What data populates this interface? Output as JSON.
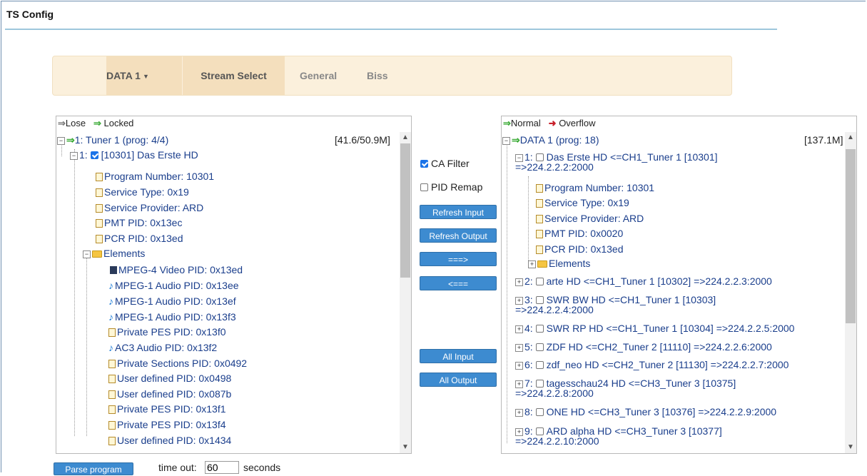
{
  "title": "TS Config",
  "tabs": [
    {
      "label": "DATA 1"
    },
    {
      "label": "Stream Select"
    },
    {
      "label": "General"
    },
    {
      "label": "Biss"
    }
  ],
  "input_panel": {
    "legend_lose": "Lose",
    "legend_locked": "Locked",
    "root_label": "1: Tuner 1 (prog: 4/4)",
    "root_rate": "[41.6/50.9M]",
    "program_label": "1:",
    "program_name": "[10301] Das Erste HD",
    "details": [
      "Program Number: 10301",
      "Service Type: 0x19",
      "Service Provider: ARD",
      "PMT PID: 0x13ec",
      "PCR PID: 0x13ed"
    ],
    "elements_label": "Elements",
    "elements": [
      {
        "text": "MPEG-4 Video PID: 0x13ed",
        "icon": "video-icon"
      },
      {
        "text": "MPEG-1 Audio PID: 0x13ee",
        "icon": "audio-icon"
      },
      {
        "text": "MPEG-1 Audio PID: 0x13ef",
        "icon": "audio-icon"
      },
      {
        "text": "MPEG-1 Audio PID: 0x13f3",
        "icon": "audio-icon"
      },
      {
        "text": "Private PES PID: 0x13f0",
        "icon": "doc-icon"
      },
      {
        "text": "AC3 Audio PID: 0x13f2",
        "icon": "audio-icon"
      },
      {
        "text": "Private Sections PID: 0x0492",
        "icon": "doc-icon"
      },
      {
        "text": "User defined PID: 0x0498",
        "icon": "doc-icon"
      },
      {
        "text": "User defined PID: 0x087b",
        "icon": "doc-icon"
      },
      {
        "text": "Private PES PID: 0x13f1",
        "icon": "doc-icon"
      },
      {
        "text": "Private PES PID: 0x13f4",
        "icon": "doc-icon"
      },
      {
        "text": "User defined PID: 0x1434",
        "icon": "doc-icon"
      }
    ]
  },
  "middle": {
    "ca_filter": "CA Filter",
    "ca_filter_checked": true,
    "pid_remap": "PID Remap",
    "pid_remap_checked": false,
    "refresh_input": "Refresh Input",
    "refresh_output": "Refresh Output",
    "forward": "===>",
    "back": "<===",
    "all_input": "All Input",
    "all_output": "All Output"
  },
  "output_panel": {
    "legend_normal": "Normal",
    "legend_overflow": "Overflow",
    "root_label": "DATA 1 (prog: 18)",
    "root_rate": "[137.1M]",
    "first_program_line1": "1: ",
    "first_program_name": "Das Erste HD <=CH1_Tuner 1 [10301]",
    "first_program_line2": "=>224.2.2.2:2000",
    "details": [
      "Program Number: 10301",
      "Service Type: 0x19",
      "Service Provider: ARD",
      "PMT PID: 0x0020",
      "PCR PID: 0x13ed"
    ],
    "elements_label": "Elements",
    "programs": [
      {
        "line1": "2:",
        "text": "arte HD <=CH1_Tuner 1 [10302] =>224.2.2.3:2000",
        "line2": ""
      },
      {
        "line1": "3:",
        "text": "SWR BW HD <=CH1_Tuner 1 [10303]",
        "line2": "=>224.2.2.4:2000"
      },
      {
        "line1": "4:",
        "text": "SWR RP HD <=CH1_Tuner 1 [10304] =>224.2.2.5:2000",
        "line2": ""
      },
      {
        "line1": "5:",
        "text": "ZDF HD <=CH2_Tuner 2 [11110] =>224.2.2.6:2000",
        "line2": ""
      },
      {
        "line1": "6:",
        "text": "zdf_neo HD <=CH2_Tuner 2 [11130] =>224.2.2.7:2000",
        "line2": ""
      },
      {
        "line1": "7:",
        "text": "tagesschau24 HD <=CH3_Tuner 3 [10375]",
        "line2": "=>224.2.2.8:2000"
      },
      {
        "line1": "8:",
        "text": "ONE HD <=CH3_Tuner 3 [10376] =>224.2.2.9:2000",
        "line2": ""
      },
      {
        "line1": "9:",
        "text": "ARD alpha HD <=CH3_Tuner 3 [10377]",
        "line2": "=>224.2.2.10:2000"
      }
    ]
  },
  "bottom": {
    "parse_button": "Parse program",
    "timeout_label": "time out:",
    "timeout_value": "60",
    "seconds_label": "seconds"
  }
}
